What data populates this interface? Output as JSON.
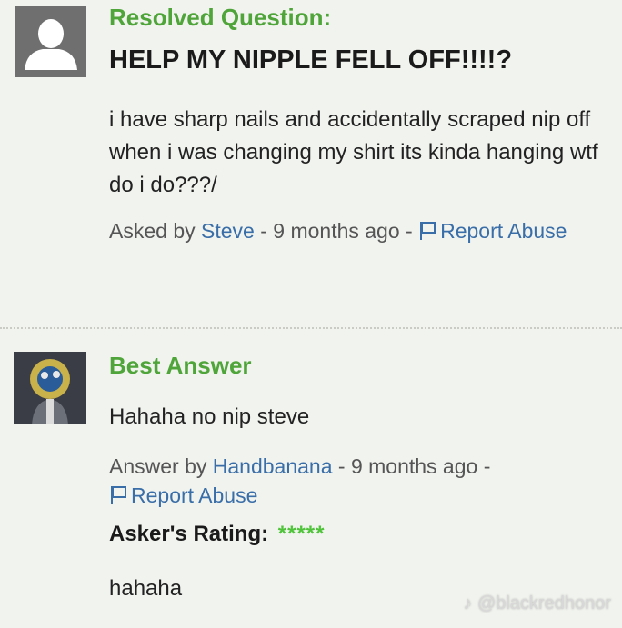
{
  "question": {
    "status": "Resolved Question:",
    "title": "HELP MY NIPPLE FELL OFF!!!!?",
    "body": "i have sharp nails and accidentally scraped nip off when i was changing my shirt its kinda hanging wtf do i do???/",
    "meta": {
      "asked_by_label": "Asked by ",
      "user": "Steve",
      "time": " - 9 months ago - ",
      "report": "Report Abuse"
    },
    "avatar_icon": "default-user-icon"
  },
  "answer": {
    "label": "Best Answer",
    "body": "Hahaha no nip steve",
    "meta": {
      "answer_by_label": "Answer by ",
      "user": "Handbanana",
      "time": " - 9 months ago - ",
      "report": "Report Abuse"
    },
    "rating_label": "Asker's Rating:",
    "stars": "*****",
    "rating_value": 5,
    "comment": "hahaha",
    "avatar_icon": "user-photo-avatar"
  },
  "watermark": "@blackredhonor",
  "colors": {
    "accent_green": "#4fa53a",
    "link_blue": "#3a6ea8",
    "star_green": "#4fc43a",
    "background": "#f1f3ee"
  }
}
